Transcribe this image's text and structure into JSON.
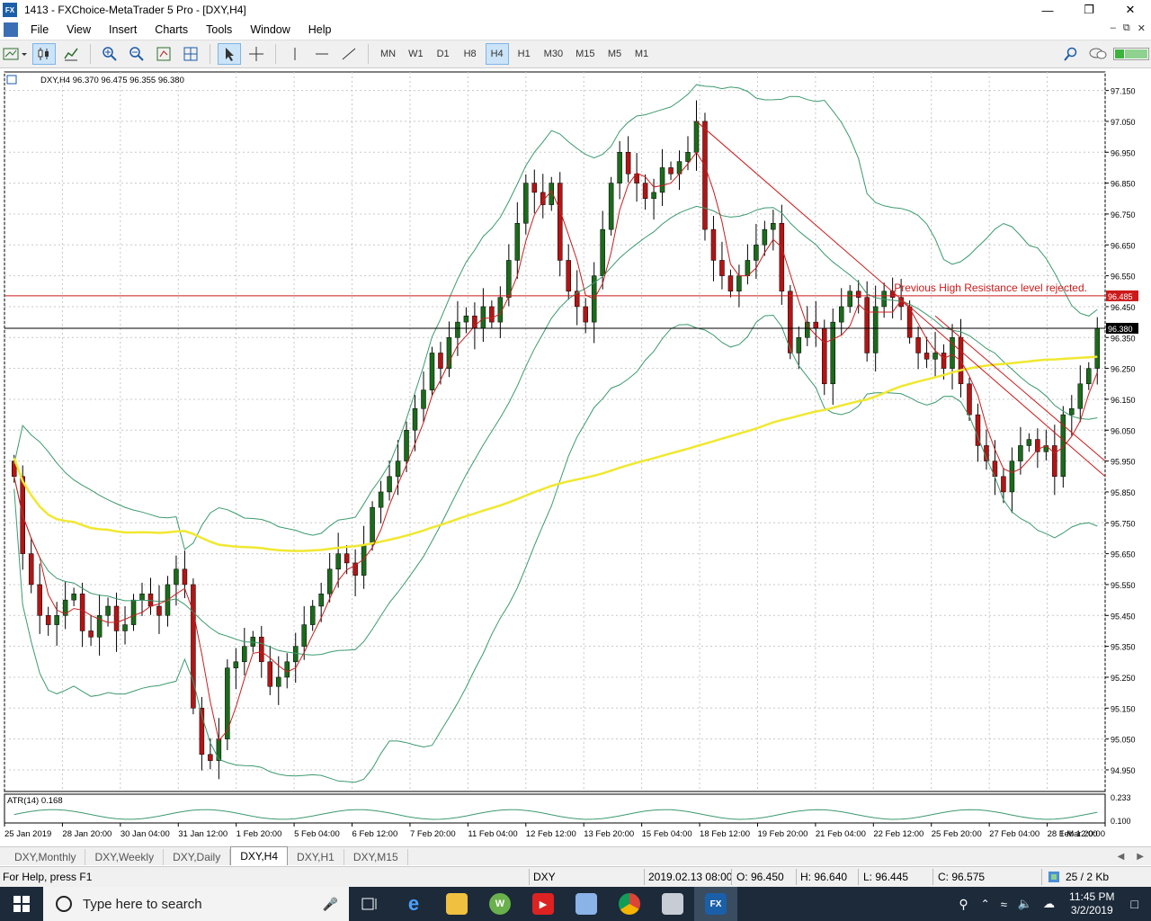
{
  "window": {
    "app_icon": "FX",
    "title": "1413 - FXChoice-MetaTrader 5 Pro - [DXY,H4]"
  },
  "menu": {
    "items": [
      "File",
      "View",
      "Insert",
      "Charts",
      "Tools",
      "Window",
      "Help"
    ]
  },
  "toolbar": {
    "timeframes": [
      "MN",
      "W1",
      "D1",
      "H8",
      "H4",
      "H1",
      "M30",
      "M15",
      "M5",
      "M1"
    ],
    "active_timeframe": "H4"
  },
  "chart": {
    "header": "DXY,H4  96.370 96.475 96.355 96.380",
    "annotation": "Previous High Resistance level rejected.",
    "resistance_label": "96.485",
    "current_price_label": "96.380",
    "atr_label": "ATR(14) 0.168",
    "atr_ticks": [
      "0.233",
      "0.100"
    ],
    "price_ticks": [
      "97.150",
      "97.050",
      "96.950",
      "96.850",
      "96.750",
      "96.650",
      "96.550",
      "96.450",
      "96.350",
      "96.250",
      "96.150",
      "96.050",
      "95.950",
      "95.850",
      "95.750",
      "95.650",
      "95.550",
      "95.450",
      "95.350",
      "95.250",
      "95.150",
      "95.050",
      "94.950"
    ],
    "time_ticks": [
      "25 Jan 2019",
      "28 Jan 20:00",
      "30 Jan 04:00",
      "31 Jan 12:00",
      "1 Feb 20:00",
      "5 Feb 04:00",
      "6 Feb 12:00",
      "7 Feb 20:00",
      "11 Feb 04:00",
      "12 Feb 12:00",
      "13 Feb 20:00",
      "15 Feb 04:00",
      "18 Feb 12:00",
      "19 Feb 20:00",
      "21 Feb 04:00",
      "22 Feb 12:00",
      "25 Feb 20:00",
      "27 Feb 04:00",
      "28 Feb 12:00",
      "1 Mar 20:00"
    ]
  },
  "chart_data": {
    "type": "candlestick",
    "title": "DXY,H4",
    "ylim": [
      94.88,
      97.21
    ],
    "close_series": [
      95.9,
      95.65,
      95.55,
      95.45,
      95.42,
      95.45,
      95.5,
      95.52,
      95.4,
      95.38,
      95.45,
      95.48,
      95.4,
      95.42,
      95.5,
      95.52,
      95.48,
      95.45,
      95.55,
      95.6,
      95.55,
      95.15,
      95.0,
      94.98,
      95.05,
      95.28,
      95.3,
      95.35,
      95.38,
      95.3,
      95.22,
      95.25,
      95.3,
      95.35,
      95.42,
      95.48,
      95.52,
      95.6,
      95.65,
      95.62,
      95.58,
      95.68,
      95.8,
      95.85,
      95.9,
      95.95,
      96.05,
      96.12,
      96.18,
      96.3,
      96.25,
      96.35,
      96.4,
      96.42,
      96.38,
      96.45,
      96.4,
      96.48,
      96.6,
      96.72,
      96.85,
      96.82,
      96.78,
      96.85,
      96.6,
      96.5,
      96.45,
      96.4,
      96.55,
      96.7,
      96.85,
      96.95,
      96.88,
      96.85,
      96.8,
      96.82,
      96.9,
      96.88,
      96.92,
      96.95,
      97.05,
      96.7,
      96.6,
      96.55,
      96.5,
      96.55,
      96.6,
      96.65,
      96.7,
      96.72,
      96.5,
      96.3,
      96.35,
      96.4,
      96.38,
      96.2,
      96.4,
      96.45,
      96.5,
      96.48,
      96.3,
      96.45,
      96.5,
      96.48,
      96.45,
      96.35,
      96.3,
      96.28,
      96.3,
      96.25,
      96.35,
      96.2,
      96.1,
      96.0,
      95.95,
      95.9,
      95.85,
      95.95,
      96.0,
      96.02,
      95.98,
      96.0,
      95.9,
      96.1,
      96.12,
      96.2,
      96.25,
      96.38
    ],
    "series": [
      {
        "name": "Resistance",
        "value": 96.485
      },
      {
        "name": "Current",
        "value": 96.38
      }
    ],
    "atr_value": 0.168
  },
  "tabs": {
    "items": [
      "DXY,Monthly",
      "DXY,Weekly",
      "DXY,Daily",
      "DXY,H4",
      "DXY,H1",
      "DXY,M15"
    ],
    "active": "DXY,H4"
  },
  "status": {
    "help": "For Help, press F1",
    "symbol": "DXY",
    "datetime": "2019.02.13 08:00",
    "open": "O: 96.450",
    "high": "H: 96.640",
    "low": "L: 96.445",
    "close": "C: 96.575",
    "traffic": "25 / 2 Kb"
  },
  "taskbar": {
    "search_placeholder": "Type here to search",
    "time": "11:45 PM",
    "date": "3/2/2019"
  },
  "colors": {
    "bull": "#1b6b1b",
    "bear": "#b41414",
    "ma_long": "#f0e830",
    "ma_short": "#c81e1e",
    "band": "#3c9a6e",
    "resistance": "#cc1a1a"
  }
}
